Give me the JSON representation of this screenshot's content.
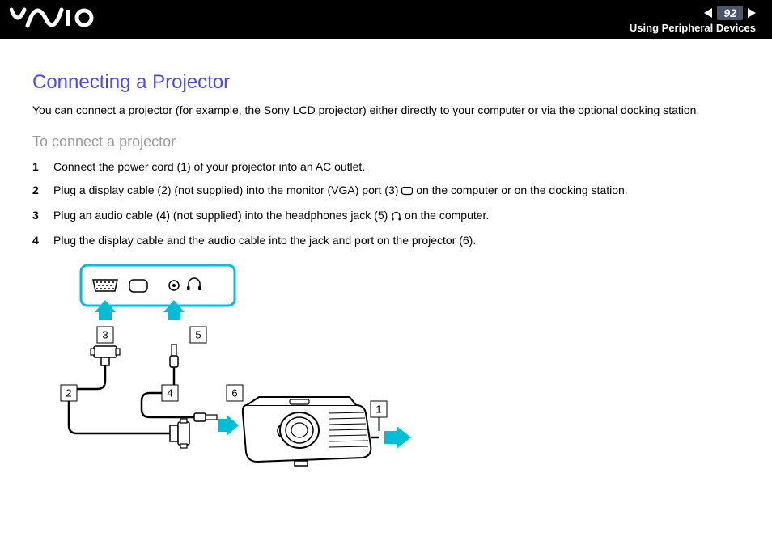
{
  "header": {
    "page_number": "92",
    "section": "Using Peripheral Devices"
  },
  "content": {
    "heading": "Connecting a Projector",
    "intro": "You can connect a projector (for example, the Sony LCD projector) either directly to your computer or via the optional docking station.",
    "subheading": "To connect a projector",
    "steps": [
      {
        "text_a": "Connect the power cord (1) of your projector into an AC outlet.",
        "icon": "",
        "text_b": ""
      },
      {
        "text_a": "Plug a display cable (2) (not supplied) into the monitor (VGA) port (3) ",
        "icon": "monitor",
        "text_b": " on the computer or on the docking station."
      },
      {
        "text_a": "Plug an audio cable (4) (not supplied) into the headphones jack (5) ",
        "icon": "headphones",
        "text_b": " on the computer."
      },
      {
        "text_a": "Plug the display cable and the audio cable into the jack and port on the projector (6).",
        "icon": "",
        "text_b": ""
      }
    ]
  },
  "diagram": {
    "callouts": {
      "c1": "1",
      "c2": "2",
      "c3": "3",
      "c4": "4",
      "c5": "5",
      "c6": "6"
    }
  }
}
